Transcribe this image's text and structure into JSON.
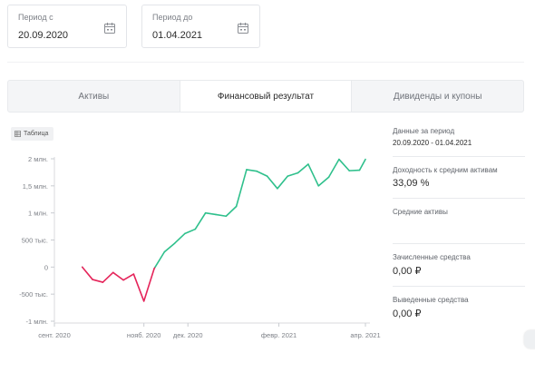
{
  "filters": {
    "from": {
      "label": "Период с",
      "value": "20.09.2020",
      "icon": "calendar-icon"
    },
    "to": {
      "label": "Период до",
      "value": "01.04.2021",
      "icon": "calendar-icon"
    }
  },
  "tabs": [
    {
      "label": "Активы",
      "active": false
    },
    {
      "label": "Финансовый результат",
      "active": true
    },
    {
      "label": "Дивиденды и купоны",
      "active": false
    }
  ],
  "table_button": {
    "label": "Таблица",
    "icon": "table-icon"
  },
  "summary": {
    "period_label": "Данные за период",
    "period_value": "20.09.2020 - 01.04.2021",
    "yield_label": "Доходность к средним активам",
    "yield_value": "33,09 %",
    "avg_assets_label": "Средние активы",
    "avg_assets_value": "",
    "credited_label": "Зачисленные средства",
    "credited_value": "0,00 ₽",
    "withdrawn_label": "Выведенные средства",
    "withdrawn_value": "0,00 ₽"
  },
  "chart_data": {
    "type": "line",
    "title": "",
    "xlabel": "",
    "ylabel": "",
    "ylim": [
      -1000000,
      2000000
    ],
    "grid": false,
    "y_ticks": [
      {
        "value": 2000000,
        "label": "2 млн."
      },
      {
        "value": 1500000,
        "label": "1,5 млн."
      },
      {
        "value": 1000000,
        "label": "1 млн."
      },
      {
        "value": 500000,
        "label": "500 тыс."
      },
      {
        "value": 0,
        "label": "0"
      },
      {
        "value": -500000,
        "label": "-500 тыс."
      },
      {
        "value": -1000000,
        "label": "-1 млн."
      }
    ],
    "x_ticks": [
      {
        "date": "2020-09-01",
        "label": "сент. 2020"
      },
      {
        "date": "2020-11-01",
        "label": "нояб. 2020"
      },
      {
        "date": "2020-12-01",
        "label": "дек. 2020"
      },
      {
        "date": "2021-02-01",
        "label": "февр. 2021"
      },
      {
        "date": "2021-04-01",
        "label": "апр. 2021"
      }
    ],
    "colors": {
      "negative": "#e5245a",
      "positive": "#2fc08c"
    },
    "points": [
      {
        "x": "2020-09-20",
        "y": 0
      },
      {
        "x": "2020-09-27",
        "y": -230000
      },
      {
        "x": "2020-10-04",
        "y": -280000
      },
      {
        "x": "2020-10-11",
        "y": -100000
      },
      {
        "x": "2020-10-18",
        "y": -240000
      },
      {
        "x": "2020-10-25",
        "y": -130000
      },
      {
        "x": "2020-11-01",
        "y": -630000
      },
      {
        "x": "2020-11-08",
        "y": -30000
      },
      {
        "x": "2020-11-15",
        "y": 280000
      },
      {
        "x": "2020-11-22",
        "y": 440000
      },
      {
        "x": "2020-11-29",
        "y": 620000
      },
      {
        "x": "2020-12-06",
        "y": 700000
      },
      {
        "x": "2020-12-13",
        "y": 1000000
      },
      {
        "x": "2020-12-20",
        "y": 970000
      },
      {
        "x": "2020-12-27",
        "y": 940000
      },
      {
        "x": "2021-01-03",
        "y": 1120000
      },
      {
        "x": "2021-01-10",
        "y": 1800000
      },
      {
        "x": "2021-01-17",
        "y": 1770000
      },
      {
        "x": "2021-01-24",
        "y": 1680000
      },
      {
        "x": "2021-01-31",
        "y": 1450000
      },
      {
        "x": "2021-02-07",
        "y": 1680000
      },
      {
        "x": "2021-02-14",
        "y": 1740000
      },
      {
        "x": "2021-02-21",
        "y": 1900000
      },
      {
        "x": "2021-02-28",
        "y": 1500000
      },
      {
        "x": "2021-03-07",
        "y": 1660000
      },
      {
        "x": "2021-03-14",
        "y": 1990000
      },
      {
        "x": "2021-03-21",
        "y": 1780000
      },
      {
        "x": "2021-03-28",
        "y": 1790000
      },
      {
        "x": "2021-04-01",
        "y": 1990000
      }
    ]
  }
}
